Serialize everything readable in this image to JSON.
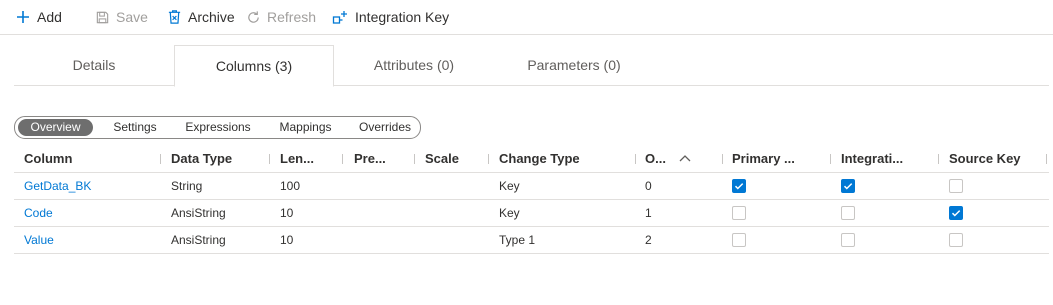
{
  "toolbar": {
    "add_label": "Add",
    "save_label": "Save",
    "archive_label": "Archive",
    "refresh_label": "Refresh",
    "integration_key_label": "Integration Key"
  },
  "tabs": [
    {
      "label": "Details",
      "active": false
    },
    {
      "label": "Columns (3)",
      "active": true
    },
    {
      "label": "Attributes (0)",
      "active": false
    },
    {
      "label": "Parameters (0)",
      "active": false
    }
  ],
  "views": [
    {
      "label": "Overview",
      "active": true
    },
    {
      "label": "Settings",
      "active": false
    },
    {
      "label": "Expressions",
      "active": false
    },
    {
      "label": "Mappings",
      "active": false
    },
    {
      "label": "Overrides",
      "active": false
    }
  ],
  "grid": {
    "headers": [
      "Column",
      "Data Type",
      "Len...",
      "Pre...",
      "Scale",
      "Change Type",
      "O...",
      "Primary ...",
      "Integrati...",
      "Source Key"
    ],
    "sort_indicator": "ascending",
    "rows": [
      {
        "column": "GetData_BK",
        "data_type": "String",
        "length": "100",
        "precision": "",
        "scale": "",
        "change_type": "Key",
        "order": "0",
        "primary": true,
        "integration": true,
        "source_key": false
      },
      {
        "column": "Code",
        "data_type": "AnsiString",
        "length": "10",
        "precision": "",
        "scale": "",
        "change_type": "Key",
        "order": "1",
        "primary": false,
        "integration": false,
        "source_key": true
      },
      {
        "column": "Value",
        "data_type": "AnsiString",
        "length": "10",
        "precision": "",
        "scale": "",
        "change_type": "Type 1",
        "order": "2",
        "primary": false,
        "integration": false,
        "source_key": false
      }
    ]
  },
  "colors": {
    "accent": "#0078d4",
    "segment_active": "#6e6e6e",
    "border": "#e1dfdd"
  }
}
